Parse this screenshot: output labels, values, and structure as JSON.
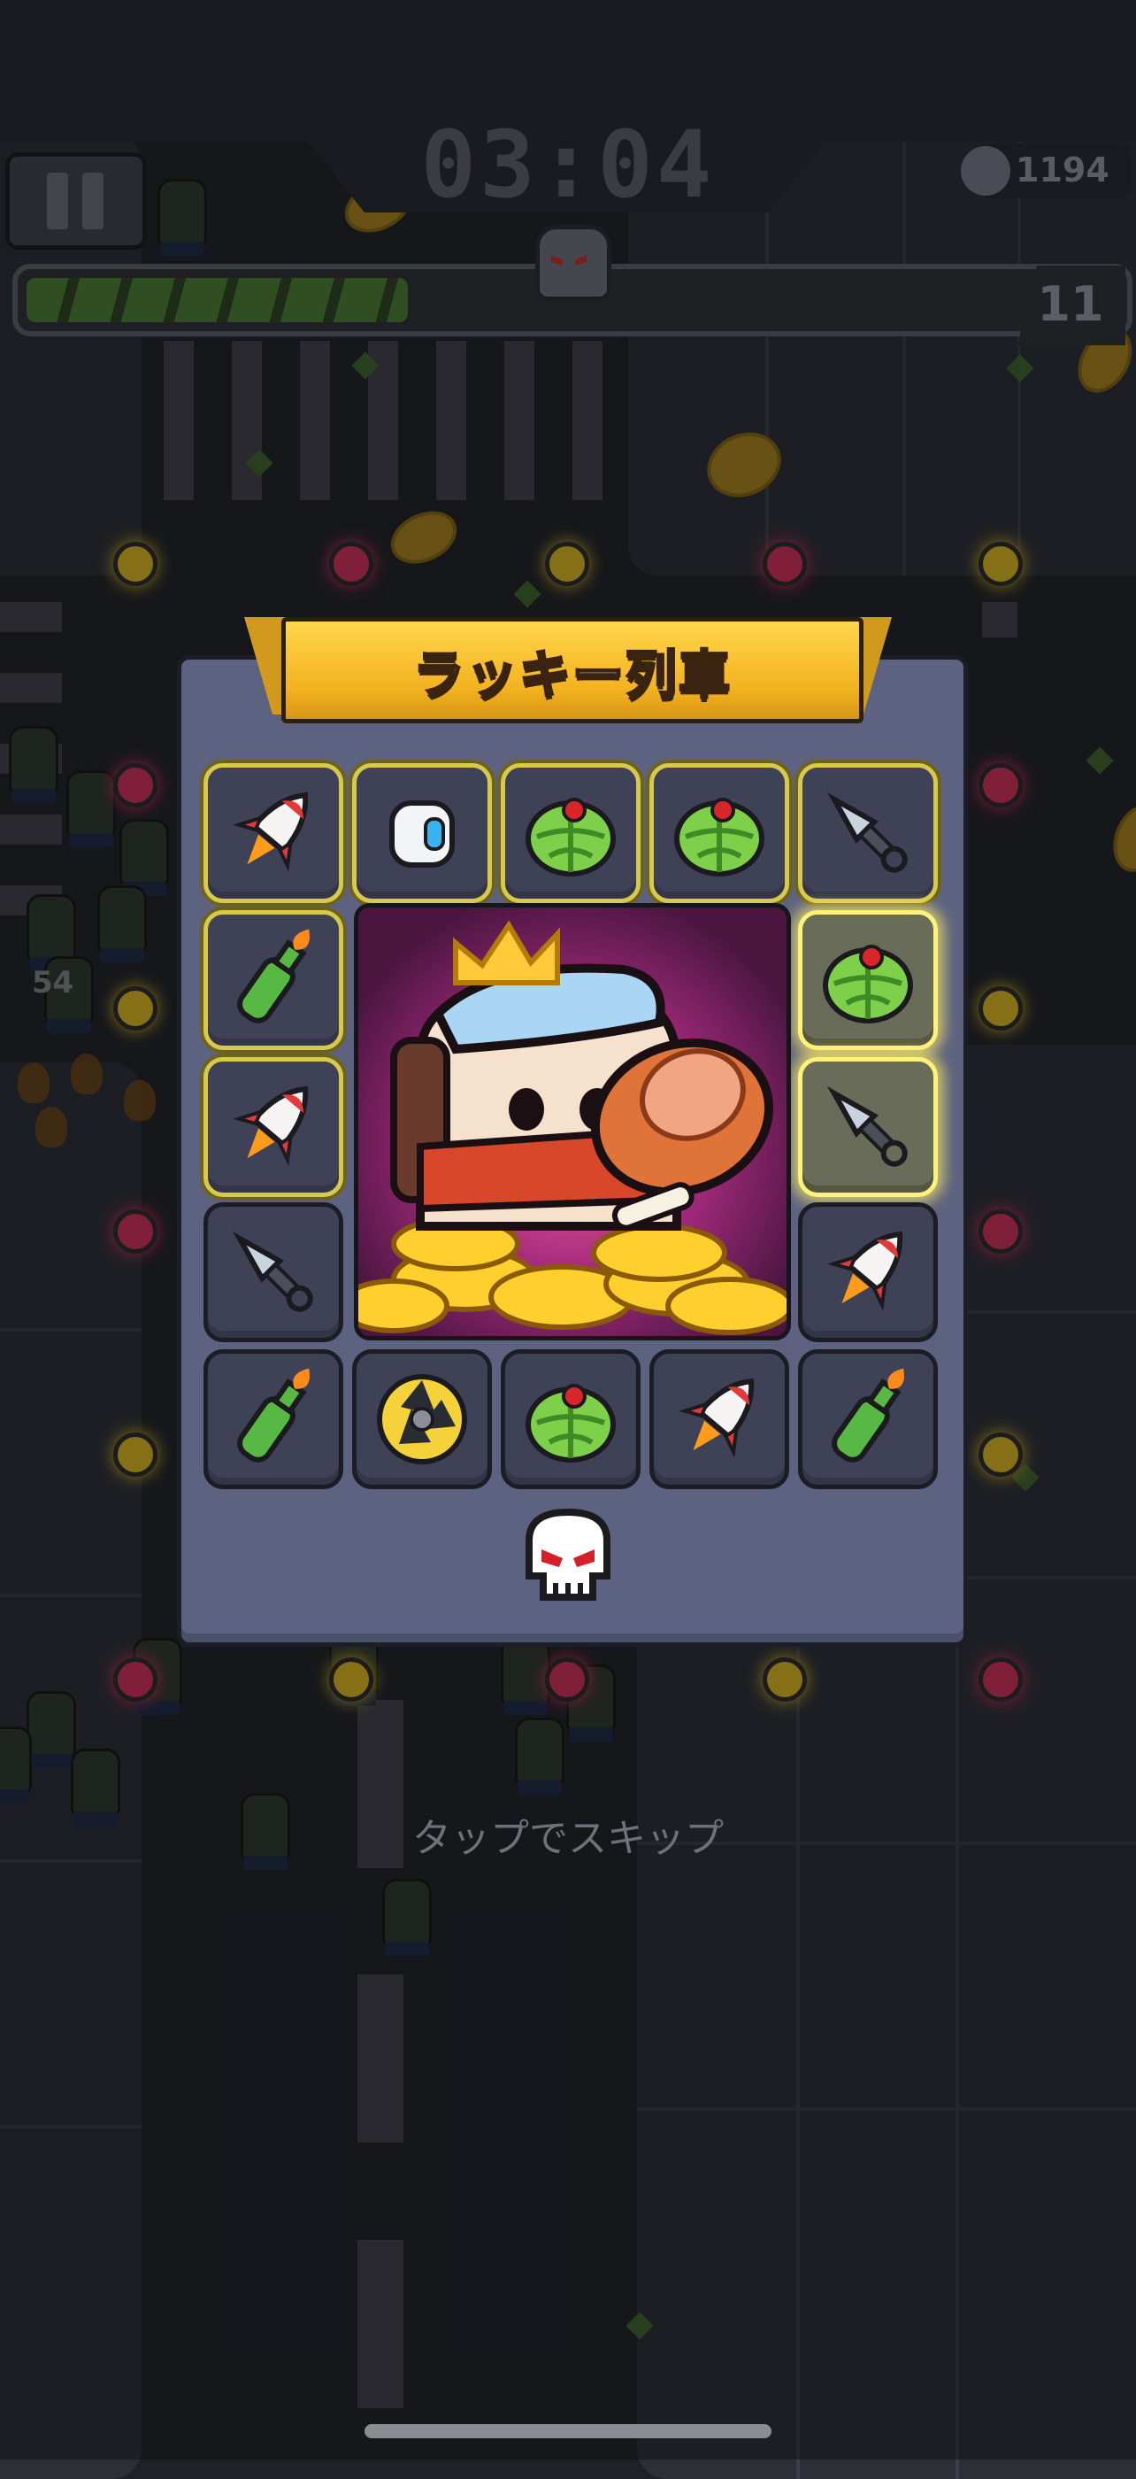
{
  "hud": {
    "timer": "03:04",
    "kill_count": "1194",
    "level": "11",
    "xp_progress": 0.35
  },
  "floating_text": {
    "damage": "54"
  },
  "panel": {
    "title": "ラッキー列車",
    "slots": [
      {
        "icon": "rocket-icon",
        "state": "lit"
      },
      {
        "icon": "drone-icon",
        "state": "lit"
      },
      {
        "icon": "watermelon-icon",
        "state": "lit"
      },
      {
        "icon": "watermelon-icon",
        "state": "lit"
      },
      {
        "icon": "kunai-icon",
        "state": "lit"
      },
      {
        "icon": "molotov-icon",
        "state": "lit"
      },
      {
        "icon": "watermelon-icon",
        "state": "glow"
      },
      {
        "icon": "rocket-icon",
        "state": "lit"
      },
      {
        "icon": "kunai-icon",
        "state": "glow"
      },
      {
        "icon": "kunai-icon",
        "state": "normal"
      },
      {
        "icon": "rocket-icon",
        "state": "normal"
      },
      {
        "icon": "molotov-icon",
        "state": "normal"
      },
      {
        "icon": "shuriken-icon",
        "state": "normal"
      },
      {
        "icon": "watermelon-icon",
        "state": "normal"
      },
      {
        "icon": "rocket-icon",
        "state": "normal"
      },
      {
        "icon": "molotov-icon",
        "state": "normal"
      }
    ],
    "center_image": "king-with-meat-and-coins",
    "bottom_icon": "skull-icon"
  },
  "skip_hint": "タップでスキップ",
  "colors": {
    "ribbon": "#f3b21f",
    "panel": "#5d6280",
    "slot": "#3f4256",
    "coin_dot": "#e9c21f",
    "pink_dot": "#e0305f",
    "xp_bar": "#2f4e22"
  }
}
